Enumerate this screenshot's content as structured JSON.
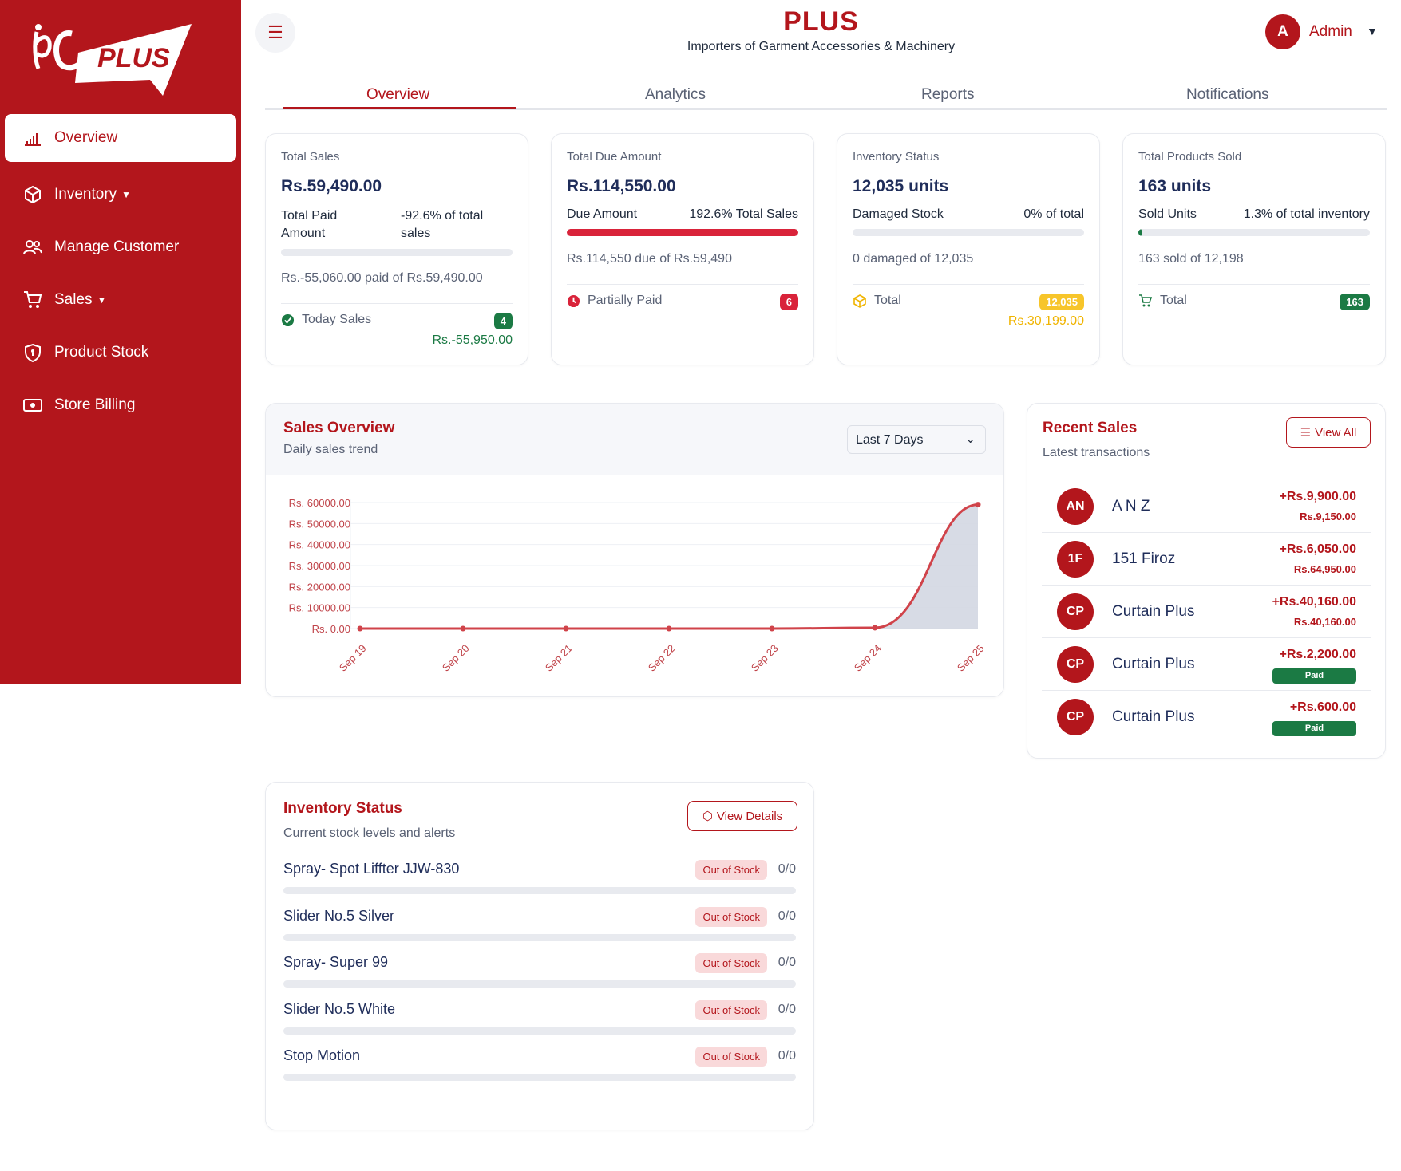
{
  "app": {
    "brand": "PLUS",
    "logo_text": "PLUS",
    "tagline": "Importers of Garment Accessories & Machinery",
    "user_initial": "A",
    "user_name": "Admin",
    "accent_color": "#b3161c"
  },
  "sidebar": {
    "items": [
      {
        "label": "Overview",
        "icon": "bar-chart-icon",
        "active": true
      },
      {
        "label": "Inventory",
        "icon": "box-icon",
        "dropdown": true
      },
      {
        "label": "Manage Customer",
        "icon": "users-icon"
      },
      {
        "label": "Sales",
        "icon": "cart-icon",
        "dropdown": true
      },
      {
        "label": "Product Stock",
        "icon": "shield-icon"
      },
      {
        "label": "Store Billing",
        "icon": "cash-icon"
      }
    ]
  },
  "tabs": [
    {
      "label": "Overview",
      "active": true
    },
    {
      "label": "Analytics"
    },
    {
      "label": "Reports"
    },
    {
      "label": "Notifications"
    }
  ],
  "stats": {
    "total_sales": {
      "label": "Total Sales",
      "value": "Rs.59,490.00",
      "left_label": "Total Paid Amount",
      "right_label": "-92.6% of total sales",
      "progress": 0,
      "summary": "Rs.-55,060.00 paid of Rs.59,490.00",
      "footer_label": "Today Sales",
      "footer_badge": "4",
      "footer_value": "Rs.-55,950.00"
    },
    "total_due": {
      "label": "Total Due Amount",
      "value": "Rs.114,550.00",
      "left_label": "Due Amount",
      "right_label": "192.6% Total Sales",
      "progress": 1.0,
      "summary": "Rs.114,550 due of Rs.59,490",
      "footer_label": "Partially Paid",
      "footer_badge": "6"
    },
    "inventory": {
      "label": "Inventory Status",
      "value": "12,035 units",
      "left_label": "Damaged Stock",
      "right_label": "0% of total",
      "progress": 0,
      "summary": "0 damaged of 12,035",
      "footer_label": "Total",
      "footer_badge": "12,035",
      "footer_value": "Rs.30,199.00"
    },
    "products_sold": {
      "label": "Total Products Sold",
      "value": "163 units",
      "left_label": "Sold Units",
      "right_label": "1.3% of total inventory",
      "progress": 0.013,
      "summary": "163 sold of 12,198",
      "footer_label": "Total",
      "footer_badge": "163"
    }
  },
  "sales_overview": {
    "title": "Sales Overview",
    "subtitle": "Daily sales trend",
    "range_selected": "Last 7 Days"
  },
  "chart_data": {
    "type": "area",
    "x": [
      "Sep 19",
      "Sep 20",
      "Sep 21",
      "Sep 22",
      "Sep 23",
      "Sep 24",
      "Sep 25"
    ],
    "series": [
      {
        "values": [
          0,
          0,
          0,
          0,
          0,
          400,
          59000
        ]
      }
    ],
    "y_ticks": [
      "Rs. 60000.00",
      "Rs. 50000.00",
      "Rs. 40000.00",
      "Rs. 30000.00",
      "Rs. 20000.00",
      "Rs. 10000.00",
      "Rs. 0.00"
    ],
    "ylim": [
      0,
      60000
    ],
    "grid": true,
    "line_color": "#d0434a",
    "fill_color": "#d3d7e2"
  },
  "recent_sales": {
    "title": "Recent Sales",
    "subtitle": "Latest transactions",
    "view_all": "View All",
    "paid_label": "Paid",
    "items": [
      {
        "initials": "AN",
        "name": "A N Z",
        "amount": "+Rs.9,900.00",
        "sub": "Rs.9,150.00"
      },
      {
        "initials": "1F",
        "name": "151 Firoz",
        "amount": "+Rs.6,050.00",
        "sub": "Rs.64,950.00"
      },
      {
        "initials": "CP",
        "name": "Curtain Plus",
        "amount": "+Rs.40,160.00",
        "sub": "Rs.40,160.00"
      },
      {
        "initials": "CP",
        "name": "Curtain Plus",
        "amount": "+Rs.2,200.00",
        "paid": true
      },
      {
        "initials": "CP",
        "name": "Curtain Plus",
        "amount": "+Rs.600.00",
        "paid": true
      }
    ]
  },
  "inventory_status": {
    "title": "Inventory Status",
    "subtitle": "Current stock levels and alerts",
    "view_details": "View Details",
    "items": [
      {
        "name": "Spray- Spot Liffter JJW-830",
        "status": "Out of Stock",
        "qty": "0/0"
      },
      {
        "name": "Slider No.5 Silver",
        "status": "Out of Stock",
        "qty": "0/0"
      },
      {
        "name": "Spray- Super 99",
        "status": "Out of Stock",
        "qty": "0/0"
      },
      {
        "name": "Slider No.5 White",
        "status": "Out of Stock",
        "qty": "0/0"
      },
      {
        "name": "Stop Motion",
        "status": "Out of Stock",
        "qty": "0/0"
      }
    ]
  }
}
